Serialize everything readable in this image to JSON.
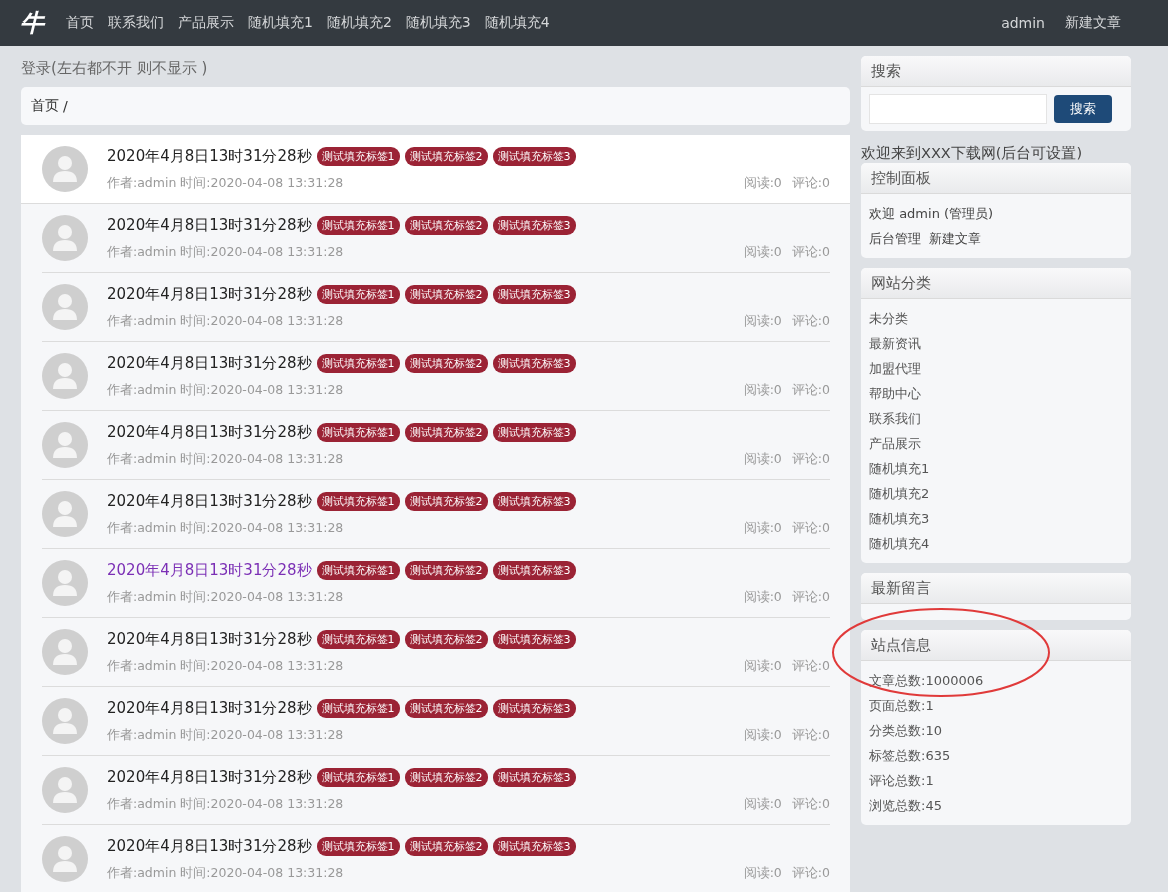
{
  "navbar": {
    "logo": "牛",
    "links": [
      "首页",
      "联系我们",
      "产品展示",
      "随机填充1",
      "随机填充2",
      "随机填充3",
      "随机填充4"
    ],
    "right_links": [
      "admin",
      "新建文章"
    ]
  },
  "login_notice": "登录(左右都不开 则不显示 )",
  "breadcrumb": {
    "items": [
      "首页"
    ],
    "separator": "/"
  },
  "posts": [
    {
      "title": "2020年4月8日13时31分28秒",
      "tags": [
        "测试填充标签1",
        "测试填充标签2",
        "测试填充标签3"
      ],
      "meta": "作者:admin 时间:2020-04-08 13:31:28",
      "reads": "阅读:0",
      "comments": "评论:0",
      "highlighted": true,
      "visited": false
    },
    {
      "title": "2020年4月8日13时31分28秒",
      "tags": [
        "测试填充标签1",
        "测试填充标签2",
        "测试填充标签3"
      ],
      "meta": "作者:admin 时间:2020-04-08 13:31:28",
      "reads": "阅读:0",
      "comments": "评论:0",
      "highlighted": false,
      "visited": false
    },
    {
      "title": "2020年4月8日13时31分28秒",
      "tags": [
        "测试填充标签1",
        "测试填充标签2",
        "测试填充标签3"
      ],
      "meta": "作者:admin 时间:2020-04-08 13:31:28",
      "reads": "阅读:0",
      "comments": "评论:0",
      "highlighted": false,
      "visited": false
    },
    {
      "title": "2020年4月8日13时31分28秒",
      "tags": [
        "测试填充标签1",
        "测试填充标签2",
        "测试填充标签3"
      ],
      "meta": "作者:admin 时间:2020-04-08 13:31:28",
      "reads": "阅读:0",
      "comments": "评论:0",
      "highlighted": false,
      "visited": false
    },
    {
      "title": "2020年4月8日13时31分28秒",
      "tags": [
        "测试填充标签1",
        "测试填充标签2",
        "测试填充标签3"
      ],
      "meta": "作者:admin 时间:2020-04-08 13:31:28",
      "reads": "阅读:0",
      "comments": "评论:0",
      "highlighted": false,
      "visited": false
    },
    {
      "title": "2020年4月8日13时31分28秒",
      "tags": [
        "测试填充标签1",
        "测试填充标签2",
        "测试填充标签3"
      ],
      "meta": "作者:admin 时间:2020-04-08 13:31:28",
      "reads": "阅读:0",
      "comments": "评论:0",
      "highlighted": false,
      "visited": false
    },
    {
      "title": "2020年4月8日13时31分28秒",
      "tags": [
        "测试填充标签1",
        "测试填充标签2",
        "测试填充标签3"
      ],
      "meta": "作者:admin 时间:2020-04-08 13:31:28",
      "reads": "阅读:0",
      "comments": "评论:0",
      "highlighted": false,
      "visited": true
    },
    {
      "title": "2020年4月8日13时31分28秒",
      "tags": [
        "测试填充标签1",
        "测试填充标签2",
        "测试填充标签3"
      ],
      "meta": "作者:admin 时间:2020-04-08 13:31:28",
      "reads": "阅读:0",
      "comments": "评论:0",
      "highlighted": false,
      "visited": false
    },
    {
      "title": "2020年4月8日13时31分28秒",
      "tags": [
        "测试填充标签1",
        "测试填充标签2",
        "测试填充标签3"
      ],
      "meta": "作者:admin 时间:2020-04-08 13:31:28",
      "reads": "阅读:0",
      "comments": "评论:0",
      "highlighted": false,
      "visited": false
    },
    {
      "title": "2020年4月8日13时31分28秒",
      "tags": [
        "测试填充标签1",
        "测试填充标签2",
        "测试填充标签3"
      ],
      "meta": "作者:admin 时间:2020-04-08 13:31:28",
      "reads": "阅读:0",
      "comments": "评论:0",
      "highlighted": false,
      "visited": false
    },
    {
      "title": "2020年4月8日13时31分28秒",
      "tags": [
        "测试填充标签1",
        "测试填充标签2",
        "测试填充标签3"
      ],
      "meta": "作者:admin 时间:2020-04-08 13:31:28",
      "reads": "阅读:0",
      "comments": "评论:0",
      "highlighted": false,
      "visited": false
    }
  ],
  "sidebar": {
    "search": {
      "title": "搜索",
      "button": "搜索"
    },
    "welcome": "欢迎来到XXX下载网(后台可设置)",
    "control_panel": {
      "title": "控制面板",
      "greeting": "欢迎 admin (管理员)",
      "links": [
        "后台管理",
        "新建文章"
      ]
    },
    "categories": {
      "title": "网站分类",
      "items": [
        "未分类",
        "最新资讯",
        "加盟代理",
        "帮助中心",
        "联系我们",
        "产品展示",
        "随机填充1",
        "随机填充2",
        "随机填充3",
        "随机填充4"
      ]
    },
    "latest_comments": {
      "title": "最新留言"
    },
    "site_info": {
      "title": "站点信息",
      "items": [
        "文章总数:1000006",
        "页面总数:1",
        "分类总数:10",
        "标签总数:635",
        "评论总数:1",
        "浏览总数:45"
      ],
      "circled": true
    }
  }
}
